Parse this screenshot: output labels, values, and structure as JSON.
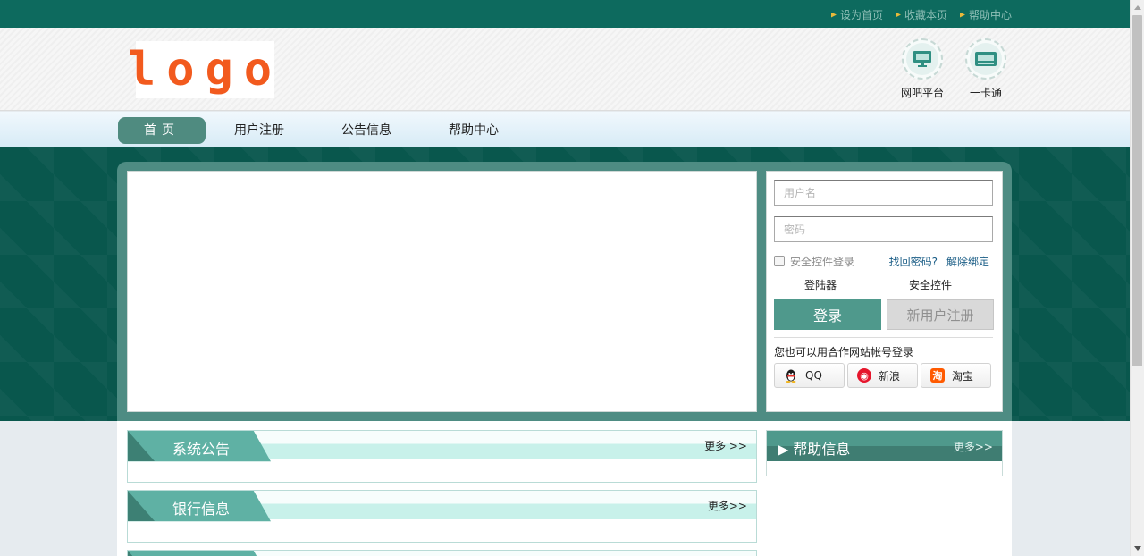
{
  "topbar": {
    "links": [
      "设为首页",
      "收藏本页",
      "帮助中心"
    ]
  },
  "header": {
    "logo_text": "logo",
    "quick_links": [
      {
        "label": "网吧平台",
        "icon": "monitor-icon"
      },
      {
        "label": "一卡通",
        "icon": "card-icon"
      }
    ]
  },
  "nav": {
    "items": [
      "首页",
      "用户注册",
      "公告信息",
      "帮助中心"
    ],
    "active": "首页"
  },
  "login": {
    "username_placeholder": "用户名",
    "password_placeholder": "密码",
    "secure_login_label": "安全控件登录",
    "find_password": "找回密码?",
    "unbind": "解除绑定",
    "launcher": "登陆器",
    "security_control": "安全控件",
    "login_button": "登录",
    "register_button": "新用户注册",
    "alt_login_text": "您也可以用合作网站帐号登录",
    "partners": [
      "QQ",
      "新浪",
      "淘宝"
    ]
  },
  "panels": [
    {
      "title": "系统公告",
      "more": "更多 >>"
    },
    {
      "title": "银行信息",
      "more": "更多>>"
    }
  ],
  "help": {
    "title": "帮助信息",
    "more": "更多>>"
  },
  "colors": {
    "brand_dark": "#0d6a5e",
    "brand": "#4f998c",
    "logo": "#f25a1e"
  }
}
